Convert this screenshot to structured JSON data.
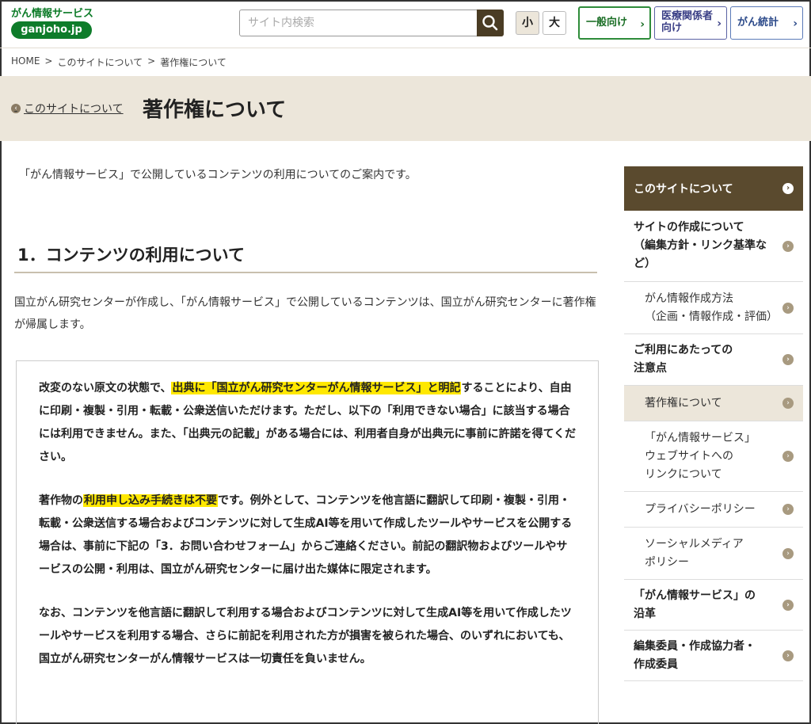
{
  "header": {
    "logo_text": "がん情報サービス",
    "logo_badge": "ganjoho.jp",
    "search_placeholder": "サイト内検索",
    "font_small": "小",
    "font_large": "大",
    "nav": [
      {
        "label": "一般向け"
      },
      {
        "label": "医療関係者向け",
        "line1": "医療関係者",
        "line2": "向け"
      },
      {
        "label": "がん統計"
      }
    ]
  },
  "breadcrumb": [
    "HOME",
    ">",
    "このサイトについて",
    ">",
    "著作権について"
  ],
  "title_band": {
    "back_link": "このサイトについて",
    "title": "著作権について"
  },
  "main": {
    "intro": "「がん情報サービス」で公開しているコンテンツの利用についてのご案内です。",
    "section_heading": "1．コンテンツの利用について",
    "para1": "国立がん研究センターが作成し、「がん情報サービス」で公開しているコンテンツは、国立がん研究センターに著作権が帰属します。",
    "notice": {
      "p1_before": "改変のない原文の状態で、",
      "p1_highlight": "出典に「国立がん研究センターがん情報サービス」と明記",
      "p1_after": "することにより、自由に印刷・複製・引用・転載・公衆送信いただけます。ただし、以下の「利用できない場合」に該当する場合には利用できません。また、「出典元の記載」がある場合には、利用者自身が出典元に事前に許諾を得てください。",
      "p2_before": "著作物の",
      "p2_highlight": "利用申し込み手続きは不要",
      "p2_after": "です。例外として、コンテンツを他言語に翻訳して印刷・複製・引用・転載・公衆送信する場合およびコンテンツに対して生成AI等を用いて作成したツールやサービスを公開する場合は、事前に下記の「3．お問い合わせフォーム」からご連絡ください。前記の翻訳物およびツールやサービスの公開・利用は、国立がん研究センターに届け出た媒体に限定されます。",
      "p3": "なお、コンテンツを他言語に翻訳して利用する場合およびコンテンツに対して生成AI等を用いて作成したツールやサービスを利用する場合、さらに前記を利用された方が損害を被られた場合、のいずれにおいても、国立がん研究センターがん情報サービスは一切責任を負いません。"
    }
  },
  "sidebar": {
    "header": "このサイトについて",
    "items": [
      {
        "label": "サイトの作成について（編集方針・リンク基準など）",
        "lines": [
          "サイトの作成について",
          "（編集方針・リンク基準な",
          "ど）"
        ],
        "level": "main"
      },
      {
        "label": "がん情報作成方法（企画・情報作成・評価）",
        "lines": [
          "がん情報作成方法",
          "（企画・情報作成・評価）"
        ],
        "level": "sub"
      },
      {
        "label": "ご利用にあたっての注意点",
        "lines": [
          "ご利用にあたっての",
          "注意点"
        ],
        "level": "main"
      },
      {
        "label": "著作権について",
        "lines": [
          "著作権について"
        ],
        "level": "sub",
        "active": true
      },
      {
        "label": "「がん情報サービス」ウェブサイトへのリンクについて",
        "lines": [
          "「がん情報サービス」",
          "ウェブサイトへの",
          "リンクについて"
        ],
        "level": "sub"
      },
      {
        "label": "プライバシーポリシー",
        "lines": [
          "プライバシーポリシー"
        ],
        "level": "sub"
      },
      {
        "label": "ソーシャルメディアポリシー",
        "lines": [
          "ソーシャルメディア",
          "ポリシー"
        ],
        "level": "sub"
      },
      {
        "label": "「がん情報サービス」の沿革",
        "lines": [
          "「がん情報サービス」の",
          "沿革"
        ],
        "level": "main"
      },
      {
        "label": "編集委員・作成協力者・作成委員",
        "lines": [
          "編集委員・作成協力者・",
          "作成委員"
        ],
        "level": "main"
      }
    ]
  },
  "colors": {
    "brand_green": "#0e7c2a",
    "band_beige": "#ece6da",
    "sidebar_dark": "#5a4a2e",
    "highlight": "#ffe800"
  }
}
